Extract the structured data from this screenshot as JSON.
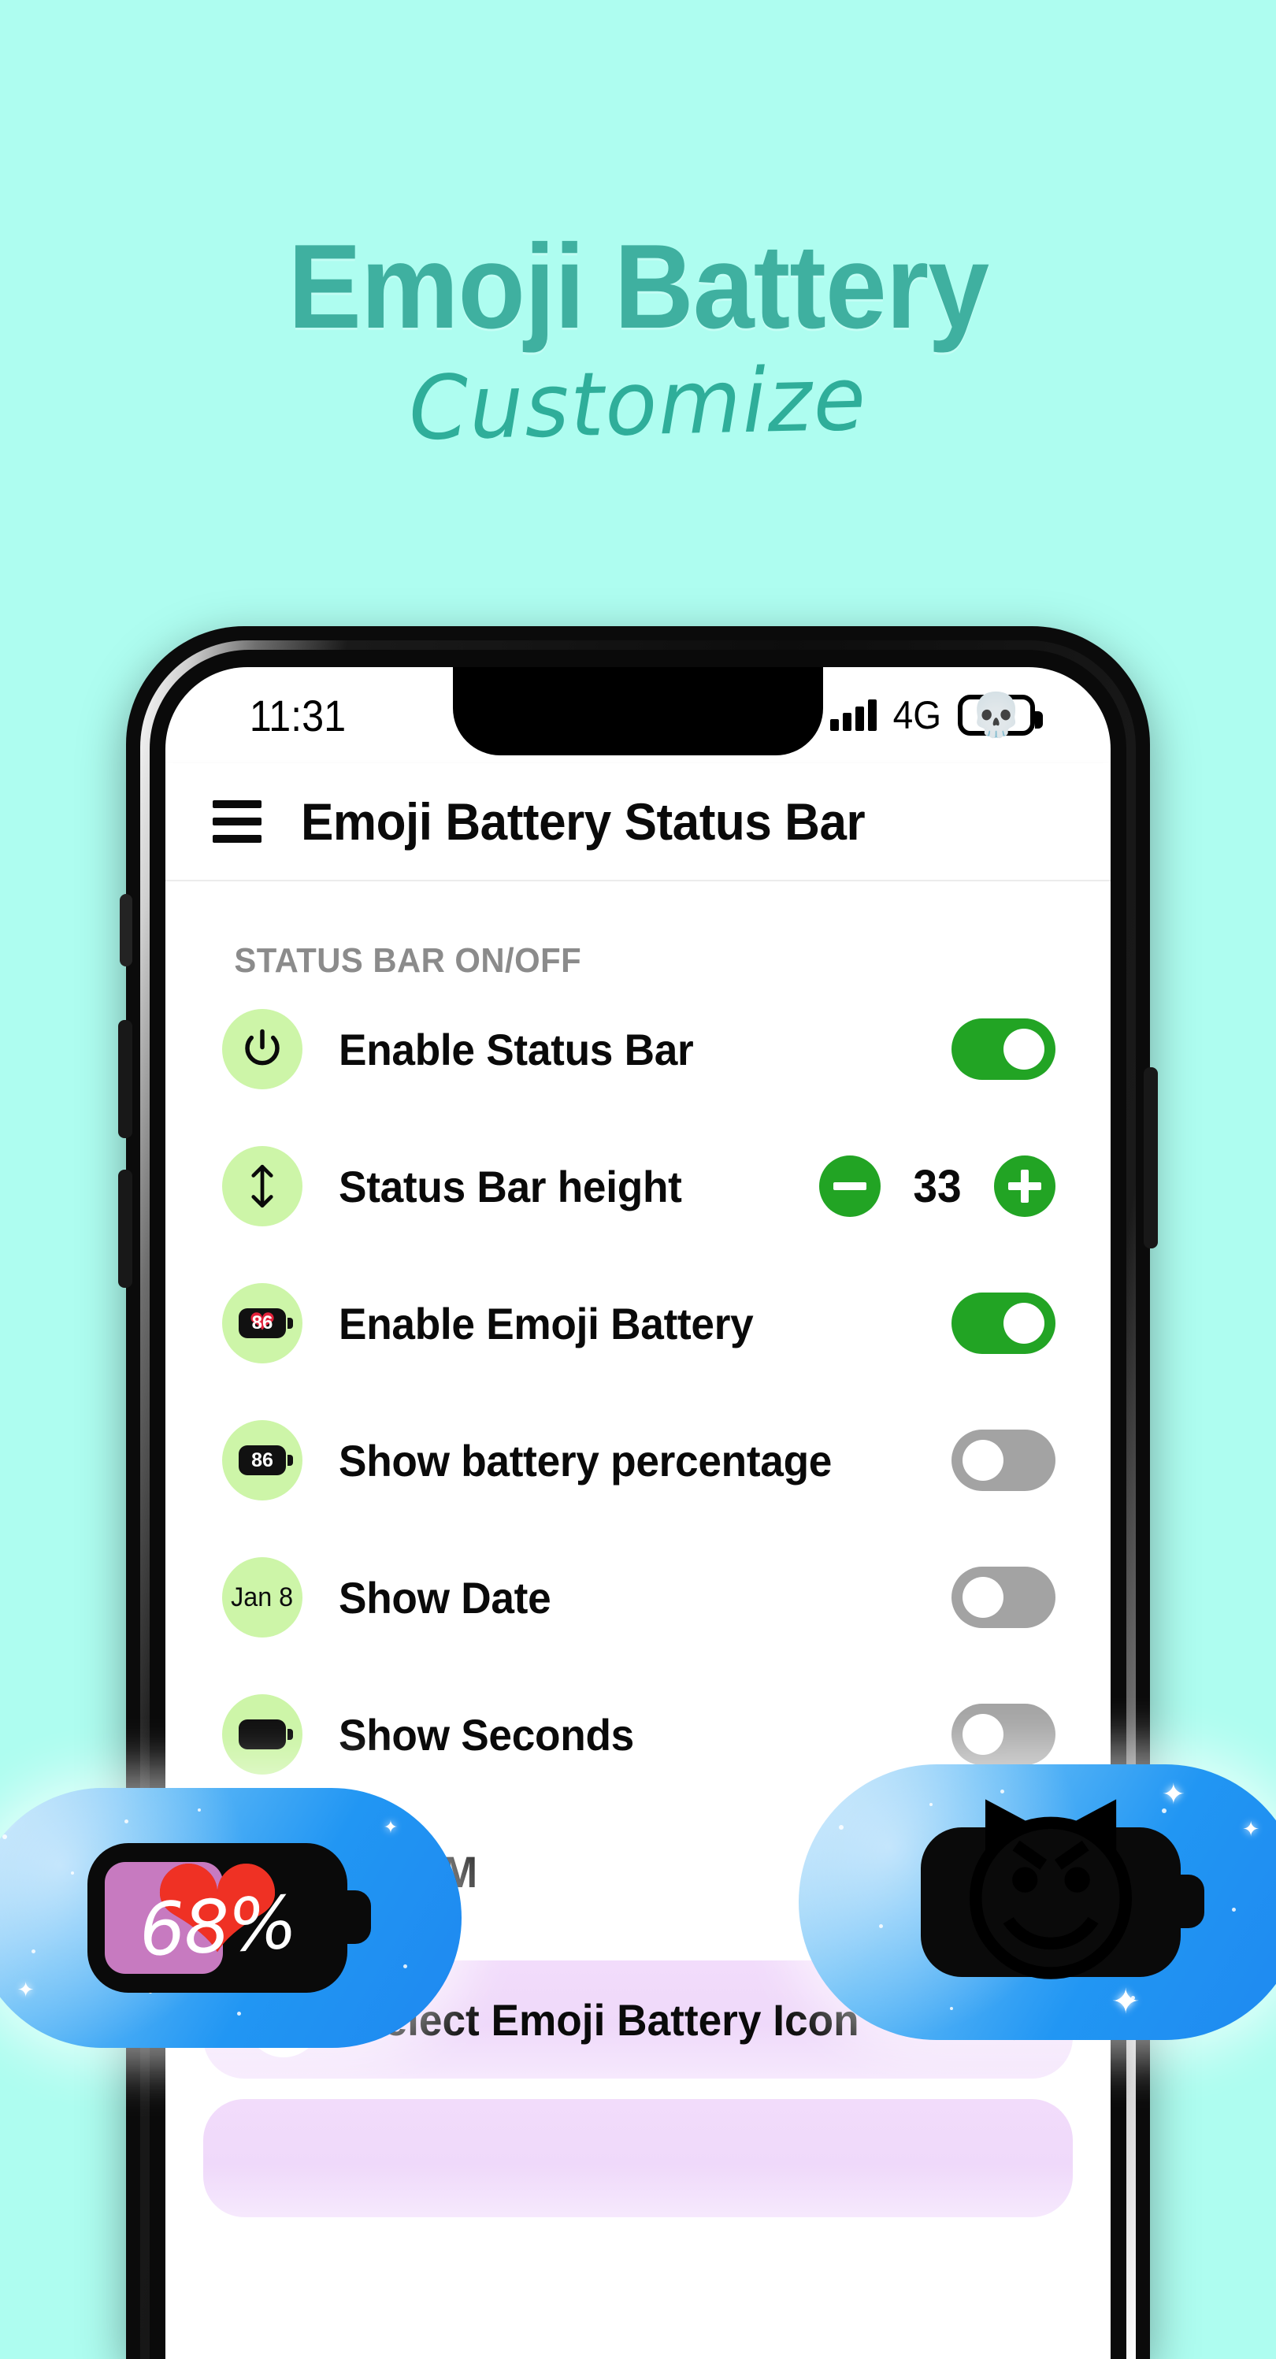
{
  "promo": {
    "title": "Emoji Battery",
    "subtitle": "Customize",
    "title_color": "#3fb0a0",
    "background_color": "#aefdf0"
  },
  "phone": {
    "status_bar": {
      "time": "11:31",
      "network": "4G",
      "signal_icon": "signal-bars-icon",
      "battery_emoji": "💀",
      "battery_icon": "battery-outline-icon"
    },
    "app_bar": {
      "menu_icon": "hamburger-menu-icon",
      "title": "Emoji Battery Status Bar"
    },
    "section_label": "STATUS BAR ON/OFF",
    "rows": [
      {
        "label": "Enable Status Bar",
        "icon": "power-icon",
        "icon_glyph": "⏻",
        "control": "toggle",
        "toggle_state": "on"
      },
      {
        "label": "Status Bar height",
        "icon": "height-arrows-icon",
        "icon_glyph": "↕",
        "control": "stepper",
        "value": "33",
        "minus_label": "−",
        "plus_label": "+"
      },
      {
        "label": "Enable Emoji Battery",
        "icon": "heart-battery-chip-icon",
        "icon_text": "86",
        "control": "toggle",
        "toggle_state": "on"
      },
      {
        "label": "Show battery percentage",
        "icon": "battery-percent-chip-icon",
        "icon_text": "86",
        "control": "toggle",
        "toggle_state": "off"
      },
      {
        "label": "Show Date",
        "icon": "date-chip-icon",
        "icon_text": "Jan 8",
        "control": "toggle",
        "toggle_state": "off"
      },
      {
        "label": "Show Seconds",
        "icon": "seconds-chip-icon",
        "icon_text": "",
        "control": "toggle",
        "toggle_state": "off"
      },
      {
        "label": "AM/PM",
        "icon": "ampm-chip-icon",
        "icon_text": "",
        "control": "toggle",
        "toggle_state": "off"
      }
    ],
    "cards": [
      {
        "label": "Select Emoji Battery Icon",
        "icon": "heart-battery-icon",
        "chevron": "chevron-right-icon"
      },
      {
        "label": "",
        "icon": "",
        "chevron": ""
      }
    ]
  },
  "overlays": {
    "left": {
      "name": "heart-battery-preview",
      "percent_text": "68%",
      "emoji": "❤",
      "fill_color": "#c77ac0",
      "background_gradient": "#2196f3"
    },
    "right": {
      "name": "devil-emoji-battery-preview",
      "emoji": "😈",
      "background_gradient": "#2196f3"
    }
  },
  "colors": {
    "accent_green": "#22a424",
    "toggle_off_gray": "#a3a3a3",
    "icon_bubble_green": "#cdf5a8",
    "card_lavender": "#f2dcfb"
  }
}
